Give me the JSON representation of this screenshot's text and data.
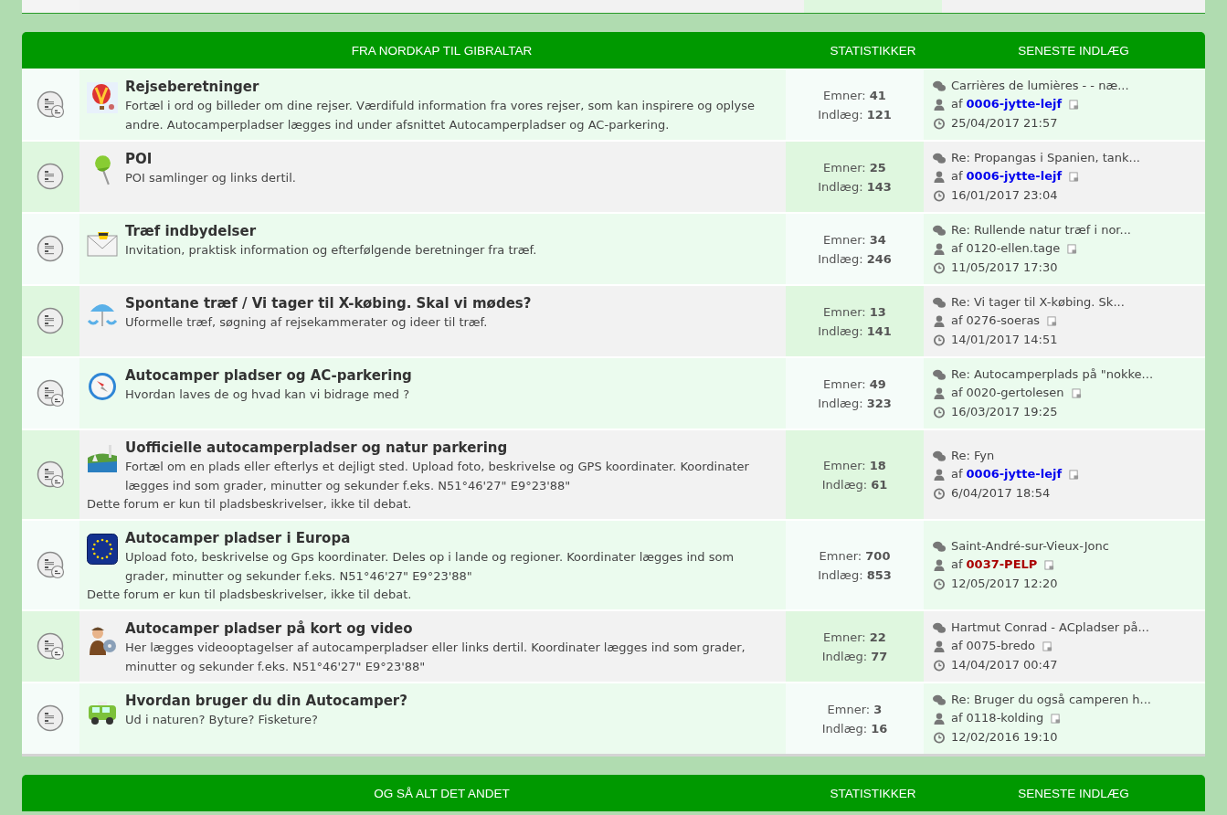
{
  "sections": [
    {
      "title": "FRA NORDKAP TIL GIBRALTAR",
      "stats_heading": "STATISTIKKER",
      "last_heading": "SENESTE INDLÆG",
      "forums": [
        {
          "name": "Rejseberetninger",
          "description": "Fortæl i ord og billeder om dine rejser. Værdifuld information fra vores rejser, som kan inspirere og oplyse andre. Autocamperpladser lægges ind under afsnittet Autocamperpladser og AC-parkering.",
          "subforums": true,
          "topics_label": "Emner:",
          "topics": "41",
          "posts_label": "Indlæg:",
          "posts": "121",
          "last_title": "Carrières de lumières - - næ...",
          "by": "af",
          "author": {
            "name": "0006-jytte-lejf",
            "color": "#0000ee"
          },
          "date": "25/04/2017 21:57"
        },
        {
          "name": "POI",
          "description": "POI samlinger og links dertil.",
          "subforums": false,
          "topics_label": "Emner:",
          "topics": "25",
          "posts_label": "Indlæg:",
          "posts": "143",
          "last_title": "Re: Propangas i Spanien, tank...",
          "by": "af",
          "author": {
            "name": "0006-jytte-lejf",
            "color": "#0000ee"
          },
          "date": "16/01/2017 23:04"
        },
        {
          "name": "Træf indbydelser",
          "description": "Invitation, praktisk information og efterfølgende beretninger fra træf.",
          "subforums": false,
          "topics_label": "Emner:",
          "topics": "34",
          "posts_label": "Indlæg:",
          "posts": "246",
          "last_title": "Re: Rullende natur træf i nor...",
          "by": "af",
          "author": {
            "name": "0120-ellen.tage"
          },
          "date": "11/05/2017 17:30"
        },
        {
          "name": "Spontane træf / Vi tager til X-købing. Skal vi mødes?",
          "description": "Uformelle træf, søgning af rejsekammerater og ideer til træf.",
          "subforums": false,
          "topics_label": "Emner:",
          "topics": "13",
          "posts_label": "Indlæg:",
          "posts": "141",
          "last_title": "Re: Vi tager til X-købing. Sk...",
          "by": "af",
          "author": {
            "name": "0276-soeras"
          },
          "date": "14/01/2017 14:51"
        },
        {
          "name": "Autocamper pladser og AC-parkering",
          "description": "Hvordan laves de og hvad kan vi bidrage med ?",
          "subforums": true,
          "topics_label": "Emner:",
          "topics": "49",
          "posts_label": "Indlæg:",
          "posts": "323",
          "last_title": "Re: Autocamperplads på \"nokke...",
          "by": "af",
          "author": {
            "name": "0020-gertolesen"
          },
          "date": "16/03/2017 19:25"
        },
        {
          "name": "Uofficielle autocamperpladser og natur parkering",
          "description": "Fortæl om en plads eller efterlys et dejligt sted. Upload foto, beskrivelse og GPS koordinater. Koordinater lægges ind som grader, minutter og sekunder f.eks. N51°46'27\" E9°23'88\"",
          "note": "Dette forum er kun til pladsbeskrivelser, ikke til debat.",
          "subforums": true,
          "topics_label": "Emner:",
          "topics": "18",
          "posts_label": "Indlæg:",
          "posts": "61",
          "last_title": "Re: Fyn",
          "by": "af",
          "author": {
            "name": "0006-jytte-lejf",
            "color": "#0000ee"
          },
          "date": "6/04/2017 18:54"
        },
        {
          "name": "Autocamper pladser i Europa",
          "description": "Upload foto, beskrivelse og Gps koordinater. Deles op i lande og regioner. Koordinater lægges ind som grader, minutter og sekunder f.eks. N51°46'27\" E9°23'88\"",
          "note": "Dette forum er kun til pladsbeskrivelser, ikke til debat.",
          "subforums": true,
          "topics_label": "Emner:",
          "topics": "700",
          "posts_label": "Indlæg:",
          "posts": "853",
          "last_title": "Saint-André-sur-Vieux-Jonc",
          "by": "af",
          "author": {
            "name": "0037-PELP",
            "color": "#aa0000"
          },
          "date": "12/05/2017 12:20"
        },
        {
          "name": "Autocamper pladser på kort og video",
          "description": "Her lægges videooptagelser af autocamperpladser eller links dertil. Koordinater lægges ind som grader, minutter og sekunder f.eks. N51°46'27\" E9°23'88\"",
          "subforums": true,
          "topics_label": "Emner:",
          "topics": "22",
          "posts_label": "Indlæg:",
          "posts": "77",
          "last_title": "Hartmut Conrad - ACpladser på...",
          "by": "af",
          "author": {
            "name": "0075-bredo"
          },
          "date": "14/04/2017 00:47"
        },
        {
          "name": "Hvordan bruger du din Autocamper?",
          "description": "Ud i naturen? Byture? Fisketure?",
          "subforums": false,
          "topics_label": "Emner:",
          "topics": "3",
          "posts_label": "Indlæg:",
          "posts": "16",
          "last_title": "Re: Bruger du også camperen h...",
          "by": "af",
          "author": {
            "name": "0118-kolding"
          },
          "date": "12/02/2016 19:10"
        }
      ]
    },
    {
      "title": "OG SÅ ALT DET ANDET",
      "stats_heading": "STATISTIKKER",
      "last_heading": "SENESTE INDLÆG"
    }
  ]
}
